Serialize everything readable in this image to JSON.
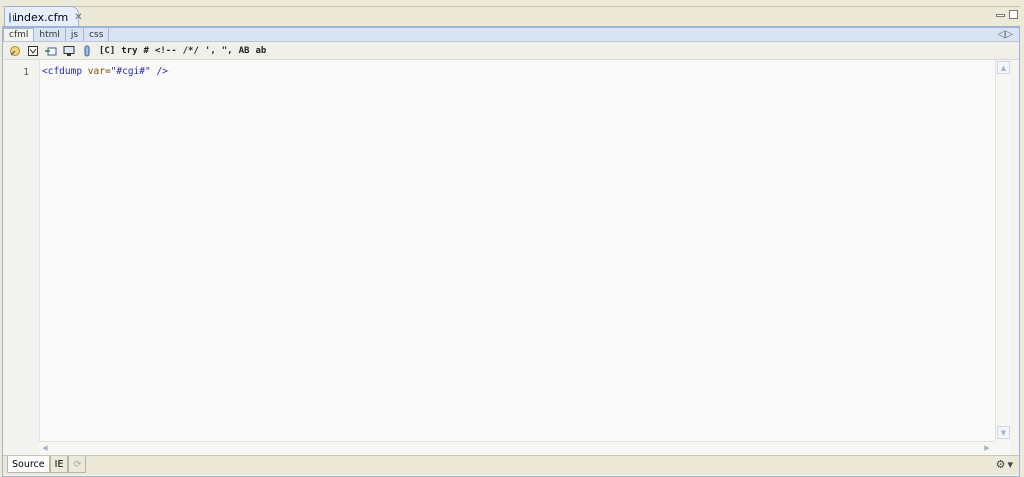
{
  "editor_tab": {
    "title": "index.cfm",
    "close_icon": "close-icon",
    "file_icon": "cfm-file-icon"
  },
  "window_buttons": {
    "minimize_icon": "minimize-icon",
    "maximize_icon": "maximize-icon"
  },
  "lang_tabs": [
    "cfml",
    "html",
    "js",
    "css"
  ],
  "lang_tabs_active": "cfml",
  "lang_arrows_icon": "collapse-arrows-icon",
  "toolbar": {
    "icons": [
      "wizard-icon",
      "tag-chooser-icon",
      "insert-icon",
      "preview-icon",
      "scope-icon"
    ],
    "text_buttons": [
      "[C]",
      "try",
      "#",
      "<!--",
      "/*/",
      "',",
      "\",",
      "AB",
      "ab"
    ]
  },
  "code": {
    "line_numbers": [
      "1"
    ],
    "line1": {
      "open": "<cfdump",
      "attr": "var=",
      "value": "\"#cgi#\"",
      "close": "/>"
    }
  },
  "bottom_tabs": {
    "source": "Source",
    "ie": "IE",
    "third_icon": "refresh-icon"
  },
  "status": {
    "icon": "globe-settings-icon",
    "dropdown_icon": "dropdown-arrow-icon"
  }
}
